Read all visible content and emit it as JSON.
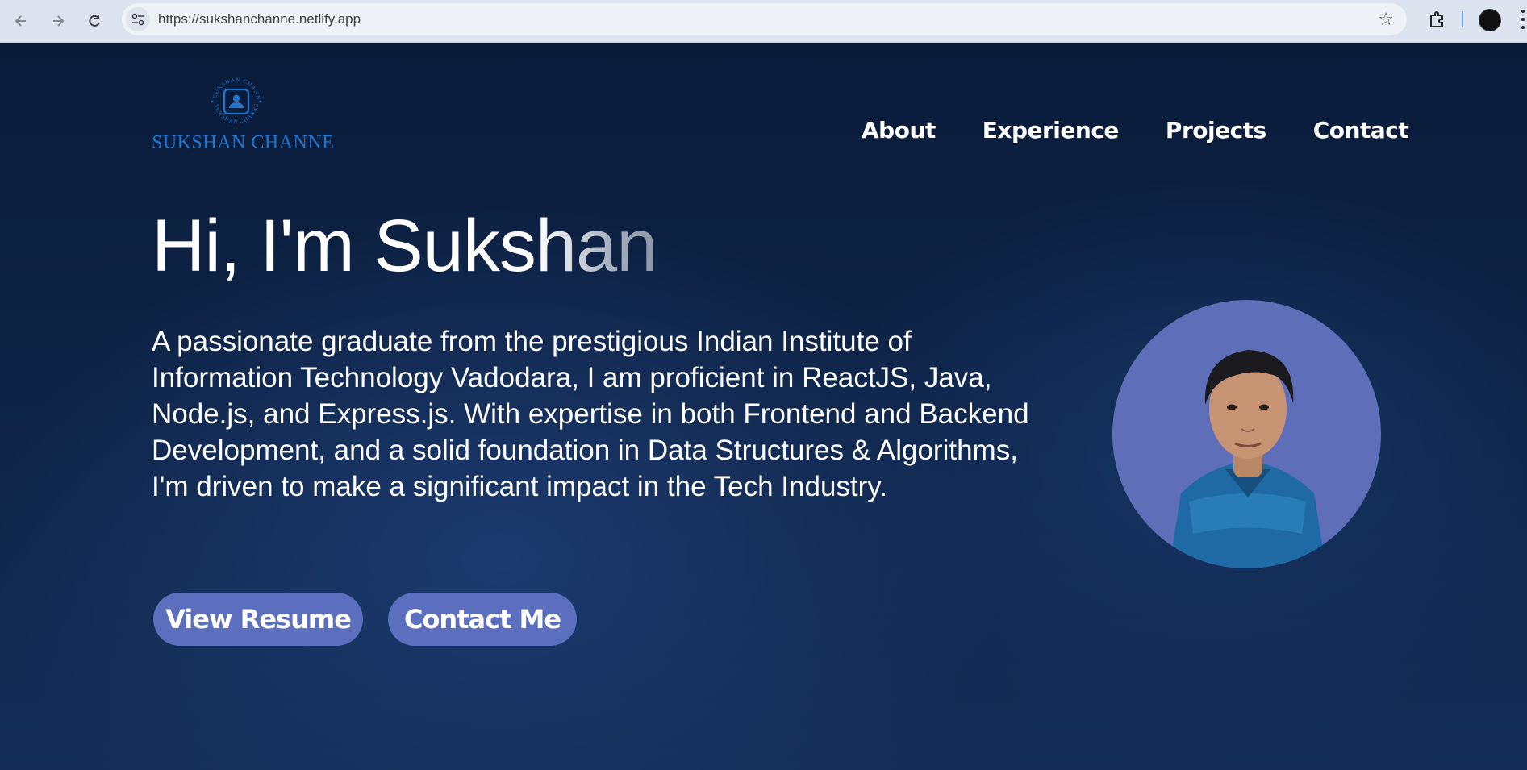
{
  "browser": {
    "url": "https://sukshanchanne.netlify.app",
    "icons": {
      "back": "arrow-left-icon",
      "forward": "arrow-right-icon",
      "reload": "reload-icon",
      "site_info": "tune-icon",
      "bookmark": "star-icon",
      "extensions": "puzzle-icon",
      "menu": "kebab-menu-icon"
    }
  },
  "header": {
    "logo_text": "SUKSHAN CHANNE",
    "logo_ring_text": "SUKSHAN CHANNE",
    "nav": [
      {
        "label": "About"
      },
      {
        "label": "Experience"
      },
      {
        "label": "Projects"
      },
      {
        "label": "Contact"
      }
    ]
  },
  "hero": {
    "greeting_solid": "Hi, I'm Suks",
    "greeting_faded": "han",
    "description": "A passionate graduate from the prestigious Indian Institute of Information Technology Vadodara, I am proficient in ReactJS, Java, Node.js, and Express.js. With expertise in both Frontend and Backend Development, and a solid foundation in Data Structures & Algorithms, I'm driven to make a significant impact in the Tech Industry.",
    "buttons": {
      "resume": "View Resume",
      "contact": "Contact Me"
    }
  },
  "colors": {
    "accent": "#5b6fbe",
    "logo": "#1f77d0",
    "avatar_bg": "#5f6eb9",
    "background": "#0f2548"
  }
}
